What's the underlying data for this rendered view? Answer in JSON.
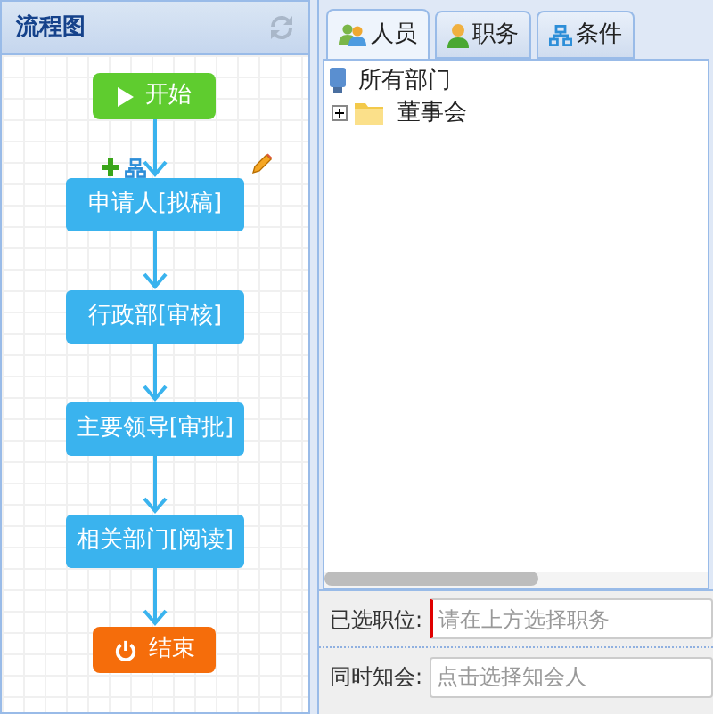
{
  "flow_panel": {
    "title": "流程图",
    "nodes": [
      {
        "kind": "start",
        "label": "开始"
      },
      {
        "kind": "task",
        "label": "申请人[拟稿]",
        "selected": true
      },
      {
        "kind": "task",
        "label": "行政部[审核]",
        "selected": false
      },
      {
        "kind": "task",
        "label": "主要领导[审批]",
        "selected": false
      },
      {
        "kind": "task",
        "label": "相关部门[阅读]",
        "selected": false
      },
      {
        "kind": "end",
        "label": "结束"
      }
    ]
  },
  "tabs": [
    {
      "label": "人员",
      "kind": "users",
      "selected": true
    },
    {
      "label": "职务",
      "kind": "user",
      "selected": false
    },
    {
      "label": "条件",
      "kind": "org",
      "selected": false
    }
  ],
  "tree": {
    "label": "所有部门",
    "children": [
      {
        "label": "董事会",
        "expanded": false
      }
    ]
  },
  "form": [
    {
      "label": "已选职位:",
      "placeholder": "请在上方选择职务",
      "required": true
    },
    {
      "label": "同时知会:",
      "placeholder": "点击选择知会人",
      "required": false
    }
  ]
}
